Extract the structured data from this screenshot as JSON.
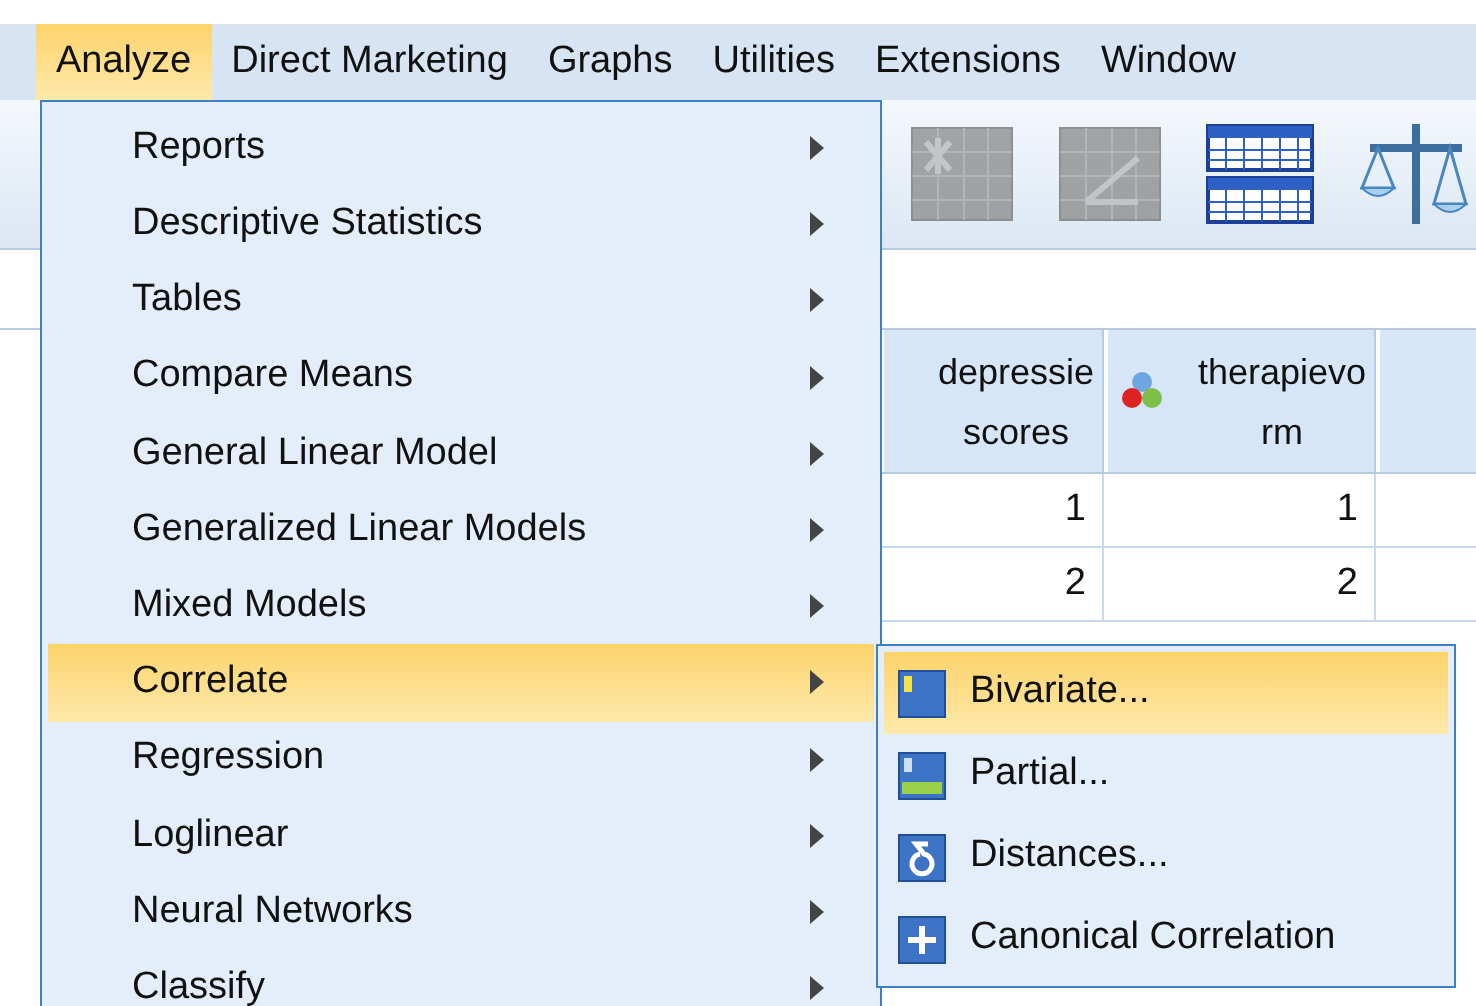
{
  "menubar": [
    {
      "label": "Analyze",
      "selected": true
    },
    {
      "label": "Direct Marketing",
      "selected": false
    },
    {
      "label": "Graphs",
      "selected": false
    },
    {
      "label": "Utilities",
      "selected": false
    },
    {
      "label": "Extensions",
      "selected": false
    },
    {
      "label": "Window",
      "selected": false
    }
  ],
  "toolbar": [
    {
      "kind": "grid-star",
      "disabled": true
    },
    {
      "kind": "grid-chart",
      "disabled": true
    },
    {
      "kind": "split-table",
      "disabled": false
    },
    {
      "kind": "scale",
      "disabled": false
    }
  ],
  "table": {
    "columns": [
      {
        "label": "depressie\nscores",
        "kind": "scale"
      },
      {
        "label": "therapievo\nrm",
        "kind": "nominal"
      },
      {
        "kind": "empty"
      }
    ],
    "rows": [
      [
        "1",
        "1",
        ""
      ],
      [
        "2",
        "2",
        ""
      ]
    ]
  },
  "menu": {
    "items": [
      {
        "label": "Reports",
        "selected": false
      },
      {
        "label": "Descriptive Statistics",
        "selected": false
      },
      {
        "label": "Tables",
        "selected": false
      },
      {
        "label": "Compare Means",
        "selected": false
      },
      {
        "label": "General Linear Model",
        "selected": false
      },
      {
        "label": "Generalized Linear Models",
        "selected": false
      },
      {
        "label": "Mixed Models",
        "selected": false
      },
      {
        "label": "Correlate",
        "selected": true
      },
      {
        "label": "Regression",
        "selected": false
      },
      {
        "label": "Loglinear",
        "selected": false
      },
      {
        "label": "Neural Networks",
        "selected": false
      },
      {
        "label": "Classify",
        "selected": false
      }
    ]
  },
  "submenu": {
    "items": [
      {
        "label": "Bivariate...",
        "kind": "bivariate",
        "selected": true
      },
      {
        "label": "Partial...",
        "kind": "partial",
        "selected": false
      },
      {
        "label": "Distances...",
        "kind": "distances",
        "selected": false
      },
      {
        "label": "Canonical Correlation",
        "kind": "canonical",
        "selected": false
      }
    ]
  }
}
